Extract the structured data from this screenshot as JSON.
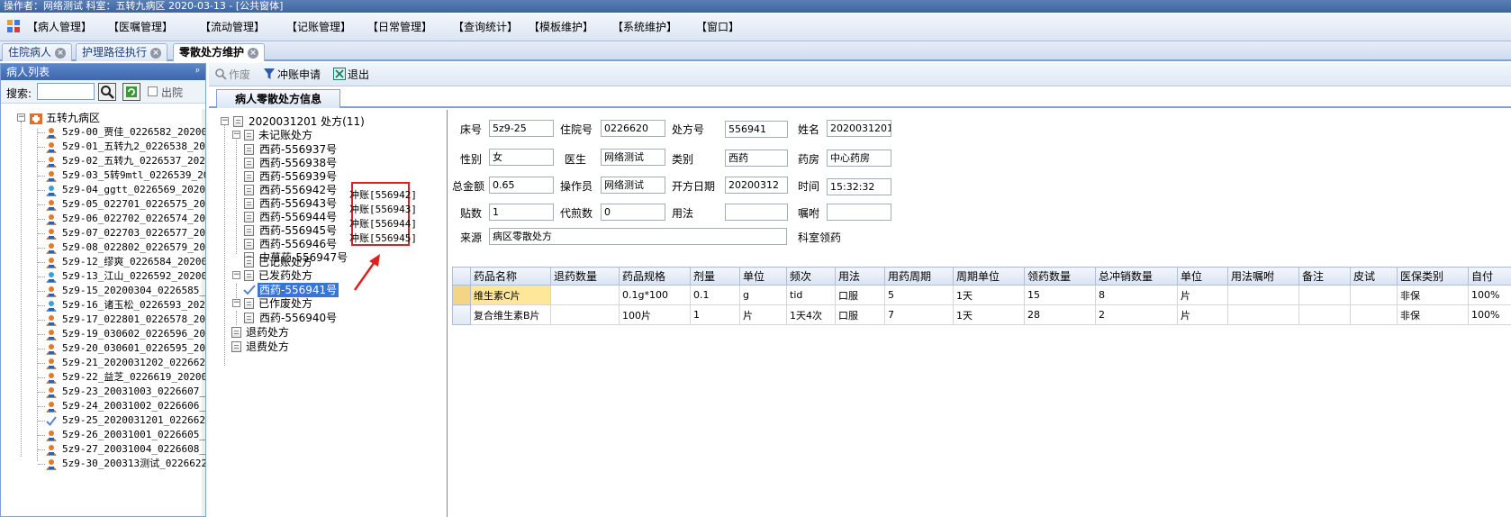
{
  "window": {
    "title": "操作者：网络测试  科室：五转九病区  2020-03-13   - [公共窗体]"
  },
  "menu": [
    "【病人管理】",
    "【医嘱管理】",
    "【流动管理】",
    "【记账管理】",
    "【日常管理】",
    "【查询统计】",
    "【模板维护】",
    "【系统维护】",
    "【窗口】"
  ],
  "doc_tabs": [
    "住院病人",
    "护理路径执行",
    "零散处方维护"
  ],
  "patient_panel": {
    "title": "病人列表",
    "search_label": "搜索:",
    "search_value": "",
    "discharged_label": "出院",
    "ward": "五转九病区",
    "patients": [
      "5z9-00_贾佳_0226582_202003",
      "5z9-01_五转九2_0226538_202",
      "5z9-02_五转九_0226537_2020",
      "5z9-03_5转9mtl_0226539_202",
      "5z9-04_ggtt_0226569_202002",
      "5z9-05_022701_0226575_2020",
      "5z9-06_022702_0226574_2020",
      "5z9-07_022703_0226577_2020",
      "5z9-08_022802_0226579_2020",
      "5z9-12_缪爽_0226584_202003",
      "5z9-13_江山_0226592_202003",
      "5z9-15_20200304_0226585_20",
      "5z9-16_诸玉松_0226593_2020",
      "5z9-17_022801_0226578_2020",
      "5z9-19_030602_0226596_2020",
      "5z9-20_030601_0226595_2020",
      "5z9-21_2020031202_0226621_",
      "5z9-22_益芝_0226619_202003",
      "5z9-23_20031003_0226607_20",
      "5z9-24_20031002_0226606_20",
      "5z9-25_2020031201_0226620_",
      "5z9-26_20031001_0226605_20",
      "5z9-27_20031004_0226608_20",
      "5z9-30_200313测试_0226622_"
    ]
  },
  "toolbar": {
    "void_label": "作废",
    "reverse_label": "冲账申请",
    "exit_label": "退出"
  },
  "sub_tab": "病人零散处方信息",
  "prescription_tree": {
    "root": "2020031201   处方(11)",
    "unbilled_label": "未记账处方",
    "unbilled": [
      "西药-556937号",
      "西药-556938号",
      "西药-556939号",
      "西药-556942号",
      "西药-556943号",
      "西药-556944号",
      "西药-556945号",
      "西药-556946号",
      "中草药-556947号"
    ],
    "billed_label": "已记账处方",
    "dispensed_label": "已发药处方",
    "dispensed": [
      "西药-556941号"
    ],
    "voided_label": "已作废处方",
    "voided": [
      "西药-556940号"
    ],
    "return_label": "退药处方",
    "refund_label": "退费处方",
    "reversal_notes": [
      "冲账[556942]",
      "冲账[556943]",
      "冲账[556944]",
      "冲账[556945]"
    ]
  },
  "form": {
    "bed_label": "床号",
    "bed": "5z9-25",
    "inpatient_no_label": "住院号",
    "inpatient_no": "0226620",
    "presc_no_label": "处方号",
    "presc_no": "556941",
    "name_label": "姓名",
    "name": "2020031201",
    "sex_label": "性别",
    "sex": "女",
    "doctor_label": "医生",
    "doctor": "网络测试",
    "category_label": "类别",
    "category": "西药",
    "pharmacy_label": "药房",
    "pharmacy": "中心药房",
    "total_label": "总金额",
    "total": "0.65",
    "operator_label": "操作员",
    "operator": "网络测试",
    "date_label": "开方日期",
    "date": "20200312",
    "time_label": "时间",
    "time": "15:32:32",
    "doses_label": "贴数",
    "doses": "1",
    "decoction_label": "代煎数",
    "decoction": "0",
    "usage_label": "用法",
    "usage": "",
    "advice_label": "嘱咐",
    "advice": "",
    "source_label": "来源",
    "source": "病区零散处方",
    "dept_pick_label": "科室领药"
  },
  "grid": {
    "columns": [
      "药品名称",
      "退药数量",
      "药品规格",
      "剂量",
      "单位",
      "频次",
      "用法",
      "用药周期",
      "周期单位",
      "领药数量",
      "总冲销数量",
      "单位",
      "用法嘱咐",
      "备注",
      "皮试",
      "医保类别",
      "自付"
    ],
    "rows": [
      [
        "维生素C片",
        "",
        "0.1g*100",
        "0.1",
        "g",
        "tid",
        "口服",
        "5",
        "1天",
        "15",
        "8",
        "片",
        "",
        "",
        "",
        "非保",
        "100%"
      ],
      [
        "复合维生素B片",
        "",
        "100片",
        "1",
        "片",
        "1天4次",
        "口服",
        "7",
        "1天",
        "28",
        "2",
        "片",
        "",
        "",
        "",
        "非保",
        "100%"
      ]
    ]
  },
  "colors": {
    "accent": "#3d66ad",
    "highlight": "#ffe79a",
    "annotation": "#e02020",
    "selected": "#3875d7"
  }
}
